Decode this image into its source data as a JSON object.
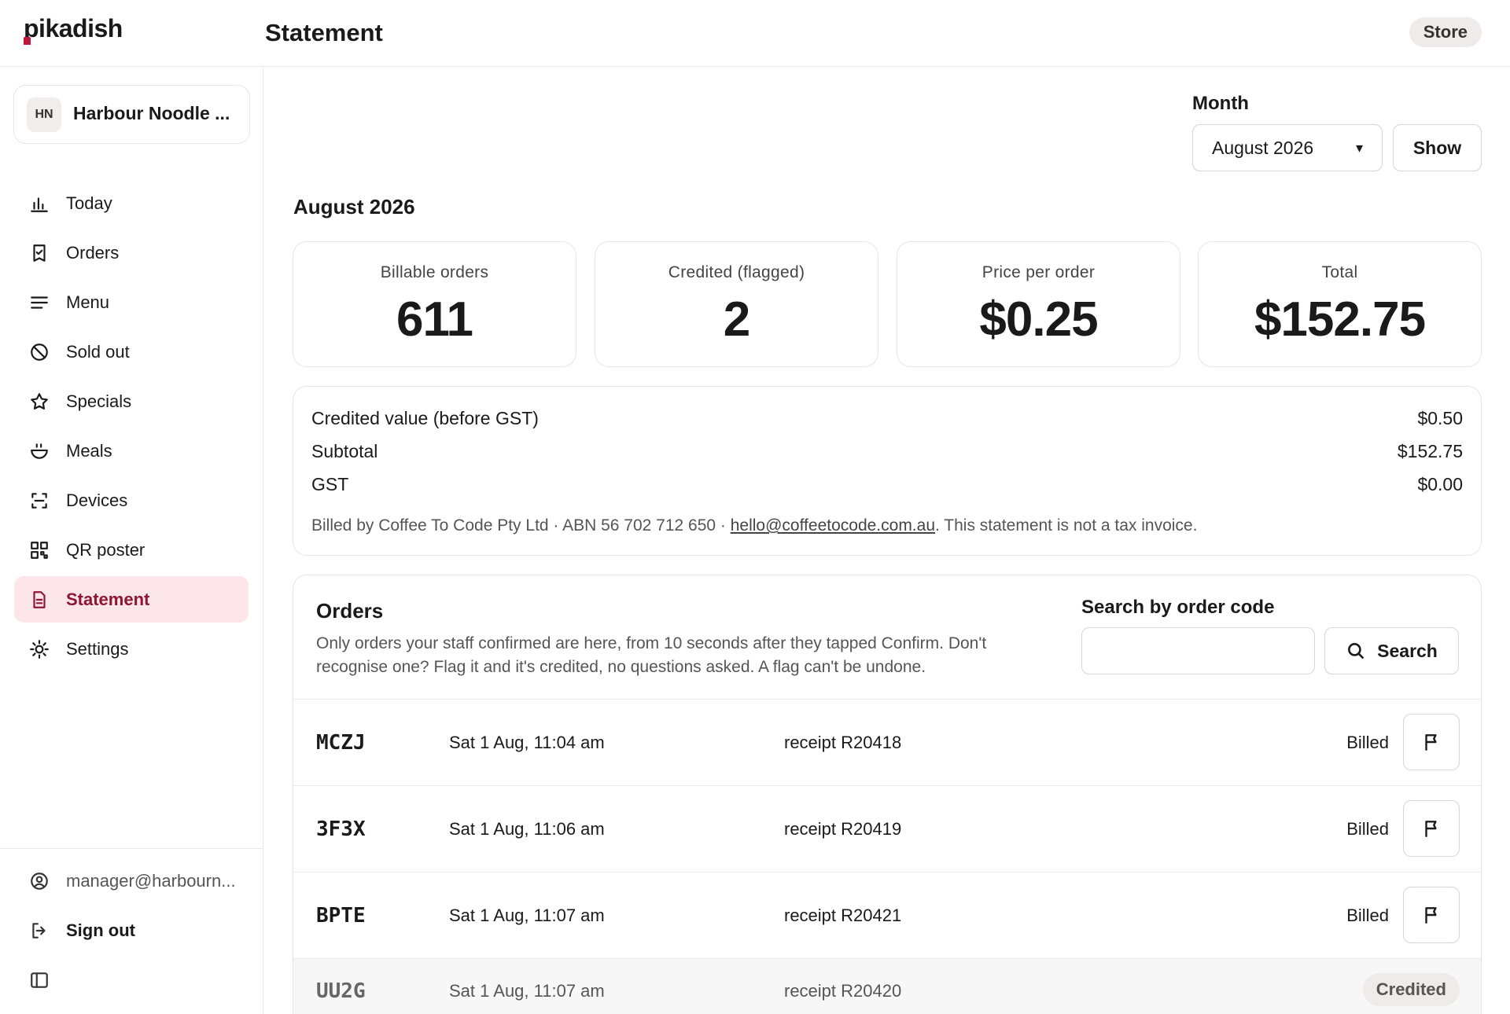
{
  "app": {
    "logo_text": "pikadish",
    "page_title": "Statement",
    "store_label": "Store"
  },
  "sidebar": {
    "restaurant": {
      "initials": "HN",
      "name": "Harbour Noodle ..."
    },
    "items": [
      {
        "label": "Today",
        "icon": "bar-chart-icon"
      },
      {
        "label": "Orders",
        "icon": "receipt-check-icon"
      },
      {
        "label": "Menu",
        "icon": "menu-lines-icon"
      },
      {
        "label": "Sold out",
        "icon": "ban-icon"
      },
      {
        "label": "Specials",
        "icon": "star-icon"
      },
      {
        "label": "Meals",
        "icon": "bowl-icon"
      },
      {
        "label": "Devices",
        "icon": "scan-frame-icon"
      },
      {
        "label": "QR poster",
        "icon": "qr-code-icon"
      },
      {
        "label": "Statement",
        "icon": "document-icon",
        "active": true
      },
      {
        "label": "Settings",
        "icon": "sun-gear-icon"
      }
    ],
    "user_email": "manager@harbourn...",
    "sign_out": "Sign out"
  },
  "filter": {
    "month_label": "Month",
    "month_value": "August 2026",
    "show_label": "Show"
  },
  "period_title": "August 2026",
  "stats": [
    {
      "label": "Billable orders",
      "value": "611"
    },
    {
      "label": "Credited (flagged)",
      "value": "2"
    },
    {
      "label": "Price per order",
      "value": "$0.25"
    },
    {
      "label": "Total",
      "value": "$152.75"
    }
  ],
  "summary": {
    "rows": [
      {
        "label": "Credited value (before GST)",
        "value": "$0.50"
      },
      {
        "label": "Subtotal",
        "value": "$152.75"
      },
      {
        "label": "GST",
        "value": "$0.00"
      }
    ],
    "billed_by": "Billed by Coffee To Code Pty Ltd · ABN 56 702 712 650 · ",
    "email": "hello@coffeetocode.com.au",
    "disclaimer": ". This statement is not a tax invoice."
  },
  "orders": {
    "title": "Orders",
    "description": "Only orders your staff confirmed are here, from 10 seconds after they tapped Confirm. Don't recognise one? Flag it and it's credited, no questions asked. A flag can't be undone.",
    "search_label": "Search by order code",
    "search_placeholder": "",
    "search_button": "Search",
    "rows": [
      {
        "code": "MCZJ",
        "time": "Sat 1 Aug, 11:04 am",
        "receipt": "receipt R20418",
        "status": "Billed"
      },
      {
        "code": "3F3X",
        "time": "Sat 1 Aug, 11:06 am",
        "receipt": "receipt R20419",
        "status": "Billed"
      },
      {
        "code": "BPTE",
        "time": "Sat 1 Aug, 11:07 am",
        "receipt": "receipt R20421",
        "status": "Billed"
      },
      {
        "code": "UU2G",
        "time": "Sat 1 Aug, 11:07 am",
        "receipt": "receipt R20420",
        "status": "Credited"
      }
    ]
  },
  "colors": {
    "accent": "#8c1634",
    "active_bg": "#fde6ea",
    "border": "#e6e6e6",
    "pill_bg": "#eeebea"
  }
}
